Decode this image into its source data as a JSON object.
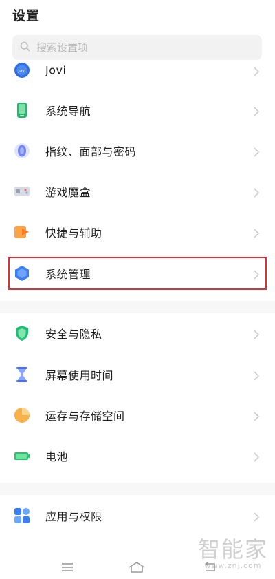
{
  "header": {
    "title": "设置"
  },
  "search": {
    "placeholder": "搜索设置项"
  },
  "settings_items": [
    {
      "label": "Jovi",
      "icon": "jovi-icon"
    },
    {
      "label": "系统导航",
      "icon": "phone-nav-icon"
    },
    {
      "label": "指纹、面部与密码",
      "icon": "fingerprint-icon"
    },
    {
      "label": "游戏魔盒",
      "icon": "game-box-icon"
    },
    {
      "label": "快捷与辅助",
      "icon": "shortcut-icon"
    },
    {
      "label": "系统管理",
      "icon": "system-management-icon"
    },
    {
      "label": "安全与隐私",
      "icon": "shield-icon"
    },
    {
      "label": "屏幕使用时间",
      "icon": "hourglass-icon"
    },
    {
      "label": "运存与存储空间",
      "icon": "storage-pie-icon"
    },
    {
      "label": "电池",
      "icon": "battery-icon"
    },
    {
      "label": "应用与权限",
      "icon": "apps-grid-icon"
    }
  ],
  "highlight_color": "#d9323b",
  "navbar": {
    "items": [
      "menu-icon",
      "home-icon",
      "back-icon"
    ]
  },
  "watermark": {
    "main": "智能家",
    "sub": "www.znj.com"
  }
}
